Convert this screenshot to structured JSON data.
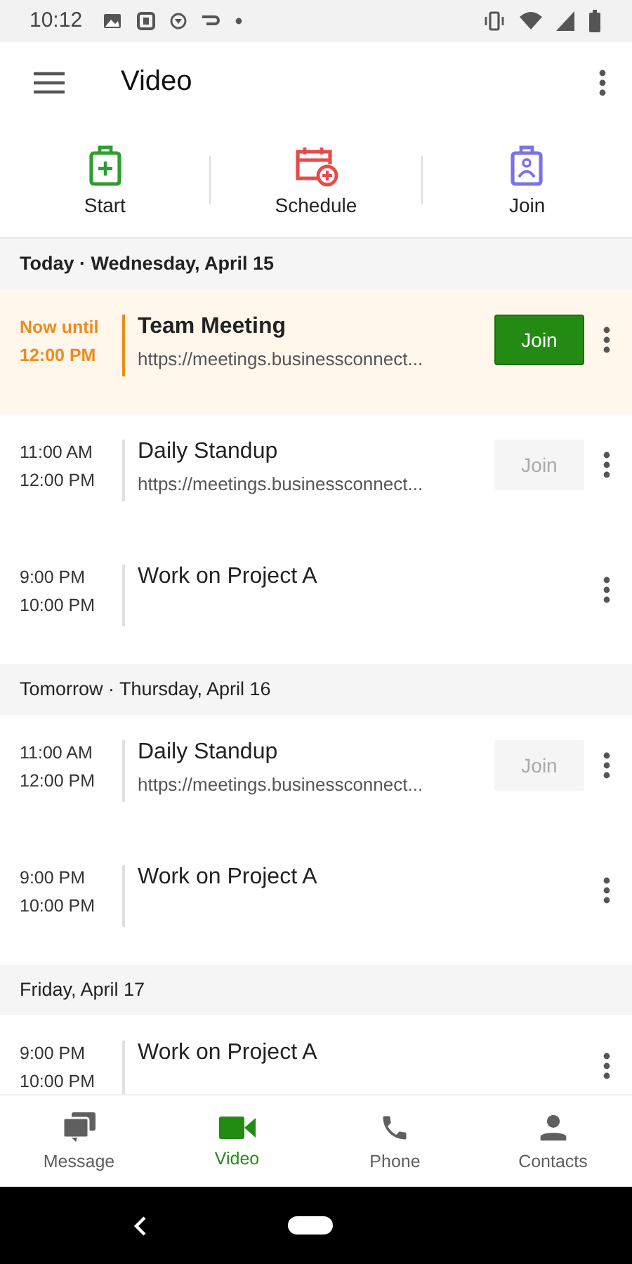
{
  "status_bar": {
    "time": "10:12"
  },
  "app_bar": {
    "title": "Video"
  },
  "actions": [
    {
      "kind": "start",
      "label": "Start"
    },
    {
      "kind": "schedule",
      "label": "Schedule"
    },
    {
      "kind": "join",
      "label": "Join"
    }
  ],
  "sections": [
    {
      "header": "Today · Wednesday, April 15",
      "meetings": [
        {
          "current": true,
          "start": "Now until",
          "end": "12:00 PM",
          "title": "Team Meeting",
          "url": "https://meetings.businessconnect...",
          "join": {
            "label": "Join",
            "enabled": true
          }
        },
        {
          "current": false,
          "start": "11:00 AM",
          "end": "12:00 PM",
          "title": "Daily Standup",
          "url": "https://meetings.businessconnect...",
          "join": {
            "label": "Join",
            "enabled": false
          }
        },
        {
          "current": false,
          "start": "9:00 PM",
          "end": "10:00 PM",
          "title": "Work on Project A"
        }
      ]
    },
    {
      "header": "Tomorrow · Thursday, April 16",
      "meetings": [
        {
          "current": false,
          "start": "11:00 AM",
          "end": "12:00 PM",
          "title": "Daily Standup",
          "url": "https://meetings.businessconnect...",
          "join": {
            "label": "Join",
            "enabled": false
          }
        },
        {
          "current": false,
          "start": "9:00 PM",
          "end": "10:00 PM",
          "title": "Work on Project A"
        }
      ]
    },
    {
      "header": "Friday, April 17",
      "meetings": [
        {
          "current": false,
          "start": "9:00 PM",
          "end": "10:00 PM",
          "title": "Work on Project A"
        }
      ]
    }
  ],
  "bottom_nav": [
    {
      "kind": "message",
      "label": "Message",
      "selected": false
    },
    {
      "kind": "video",
      "label": "Video",
      "selected": true
    },
    {
      "kind": "phone",
      "label": "Phone",
      "selected": false
    },
    {
      "kind": "contacts",
      "label": "Contacts",
      "selected": false
    }
  ]
}
